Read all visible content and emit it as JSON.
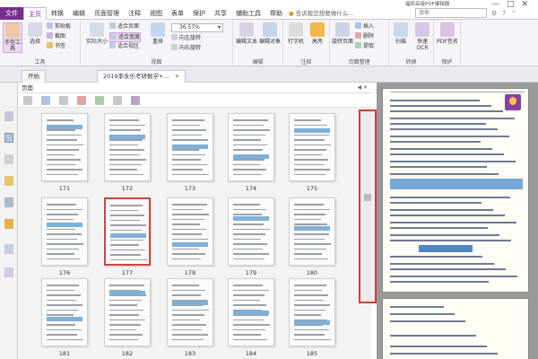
{
  "menubar": {
    "tabs": [
      "文件",
      "主页",
      "转换",
      "编辑",
      "页面管理",
      "注释",
      "视图",
      "表单",
      "保护",
      "共享",
      "辅助工具",
      "帮助"
    ],
    "active_tab": "主页",
    "tell_me": "告诉我您想要做什么...",
    "search_placeholder": "搜索",
    "window_title": "福昕高级PDF编辑器",
    "window_controls": [
      "—",
      "□",
      "✕"
    ]
  },
  "ribbon": {
    "hand_tool": "手型工具",
    "select": "选择",
    "clipboard": "剪贴板",
    "snapshot": "截图",
    "bookmark": "书签",
    "tool_group": "工具",
    "actual_size": "实际大小",
    "fit_page": "适合页面",
    "fit_width": "适合宽度",
    "fit_view": "适合视区",
    "reflow": "重排",
    "zoom_value": "36.57%",
    "rotate_left": "向左旋转",
    "rotate_right": "向右旋转",
    "view_group": "视图",
    "edit_text": "编辑文本",
    "edit_object": "编辑对象",
    "edit_group": "编辑",
    "typewriter": "打字机",
    "highlight": "高亮",
    "comment_group": "注释",
    "rotate_page": "旋转页面",
    "insert": "插入",
    "delete": "删除",
    "extract": "提取",
    "page_group": "页面整理",
    "scan": "扫描",
    "quick_ocr": "快速OCR",
    "convert_group": "转换",
    "pdf_sign": "PDF签名",
    "protect_group": "保护"
  },
  "doctabs": {
    "start": "开始",
    "file": "2019李永乐考研数学+...",
    "close": "✕"
  },
  "panel": {
    "title": "页面",
    "controls": "◀ ✕",
    "thumbnails": [
      171,
      172,
      173,
      174,
      175,
      176,
      177,
      178,
      179,
      180,
      181,
      182,
      183,
      184,
      185
    ],
    "selected_page": 177
  },
  "colors": {
    "brand": "#7b2d8e",
    "highlight_red": "#d63a3a"
  }
}
